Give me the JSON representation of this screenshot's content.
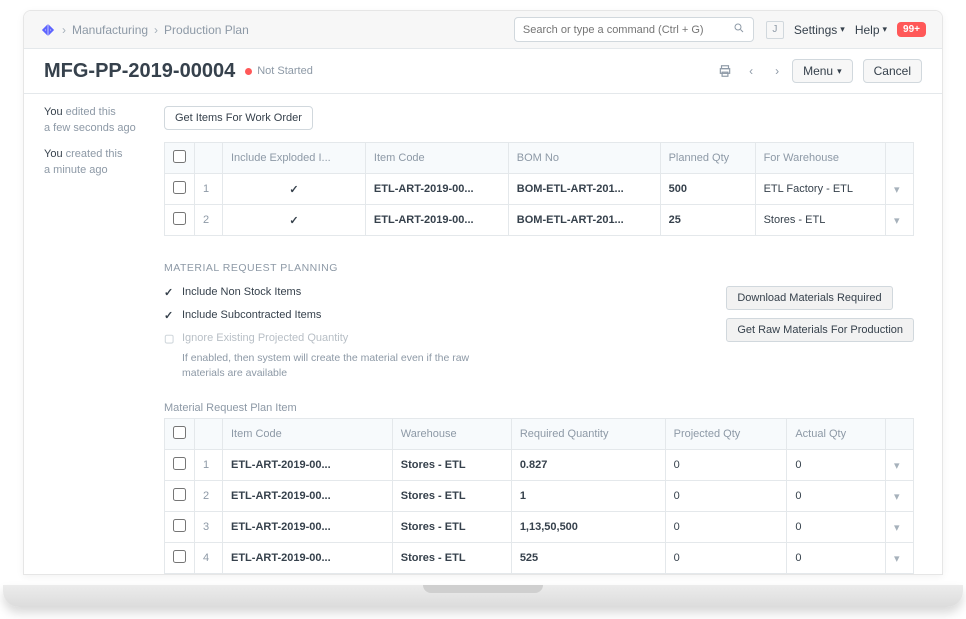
{
  "breadcrumb": {
    "a": "Manufacturing",
    "b": "Production Plan"
  },
  "search": {
    "placeholder": "Search or type a command (Ctrl + G)"
  },
  "topnav": {
    "avatar": "J",
    "settings": "Settings",
    "help": "Help",
    "badge": "99+"
  },
  "title": {
    "doc": "MFG-PP-2019-00004",
    "status": "Not Started",
    "menu": "Menu",
    "cancel": "Cancel"
  },
  "sidebar": {
    "e1a": "You",
    "e1b": "edited this",
    "e1c": "a few seconds ago",
    "e2a": "You",
    "e2b": "created this",
    "e2c": "a minute ago"
  },
  "buttons": {
    "get_items": "Get Items For Work Order",
    "download": "Download Materials Required",
    "get_raw": "Get Raw Materials For Production"
  },
  "wo_table": {
    "cols": {
      "include": "Include Exploded I...",
      "item": "Item Code",
      "bom": "BOM No",
      "qty": "Planned Qty",
      "wh": "For Warehouse"
    },
    "rows": [
      {
        "idx": "1",
        "item": "ETL-ART-2019-00...",
        "bom": "BOM-ETL-ART-201...",
        "qty": "500",
        "wh": "ETL Factory - ETL"
      },
      {
        "idx": "2",
        "item": "ETL-ART-2019-00...",
        "bom": "BOM-ETL-ART-201...",
        "qty": "25",
        "wh": "Stores - ETL"
      }
    ]
  },
  "sections": {
    "mrp": "MATERIAL REQUEST PLANNING",
    "mrpi": "Material Request Plan Item"
  },
  "opts": {
    "nonstock": "Include Non Stock Items",
    "subcon": "Include Subcontracted Items",
    "ignore": "Ignore Existing Projected Quantity",
    "ignore_help": "If enabled, then system will create the material even if the raw materials are available"
  },
  "mr_table": {
    "cols": {
      "item": "Item Code",
      "wh": "Warehouse",
      "req": "Required Quantity",
      "proj": "Projected Qty",
      "act": "Actual Qty"
    },
    "rows": [
      {
        "idx": "1",
        "item": "ETL-ART-2019-00...",
        "wh": "Stores - ETL",
        "req": "0.827",
        "proj": "0",
        "act": "0"
      },
      {
        "idx": "2",
        "item": "ETL-ART-2019-00...",
        "wh": "Stores - ETL",
        "req": "1",
        "proj": "0",
        "act": "0"
      },
      {
        "idx": "3",
        "item": "ETL-ART-2019-00...",
        "wh": "Stores - ETL",
        "req": "1,13,50,500",
        "proj": "0",
        "act": "0"
      },
      {
        "idx": "4",
        "item": "ETL-ART-2019-00...",
        "wh": "Stores - ETL",
        "req": "525",
        "proj": "0",
        "act": "0"
      }
    ]
  }
}
